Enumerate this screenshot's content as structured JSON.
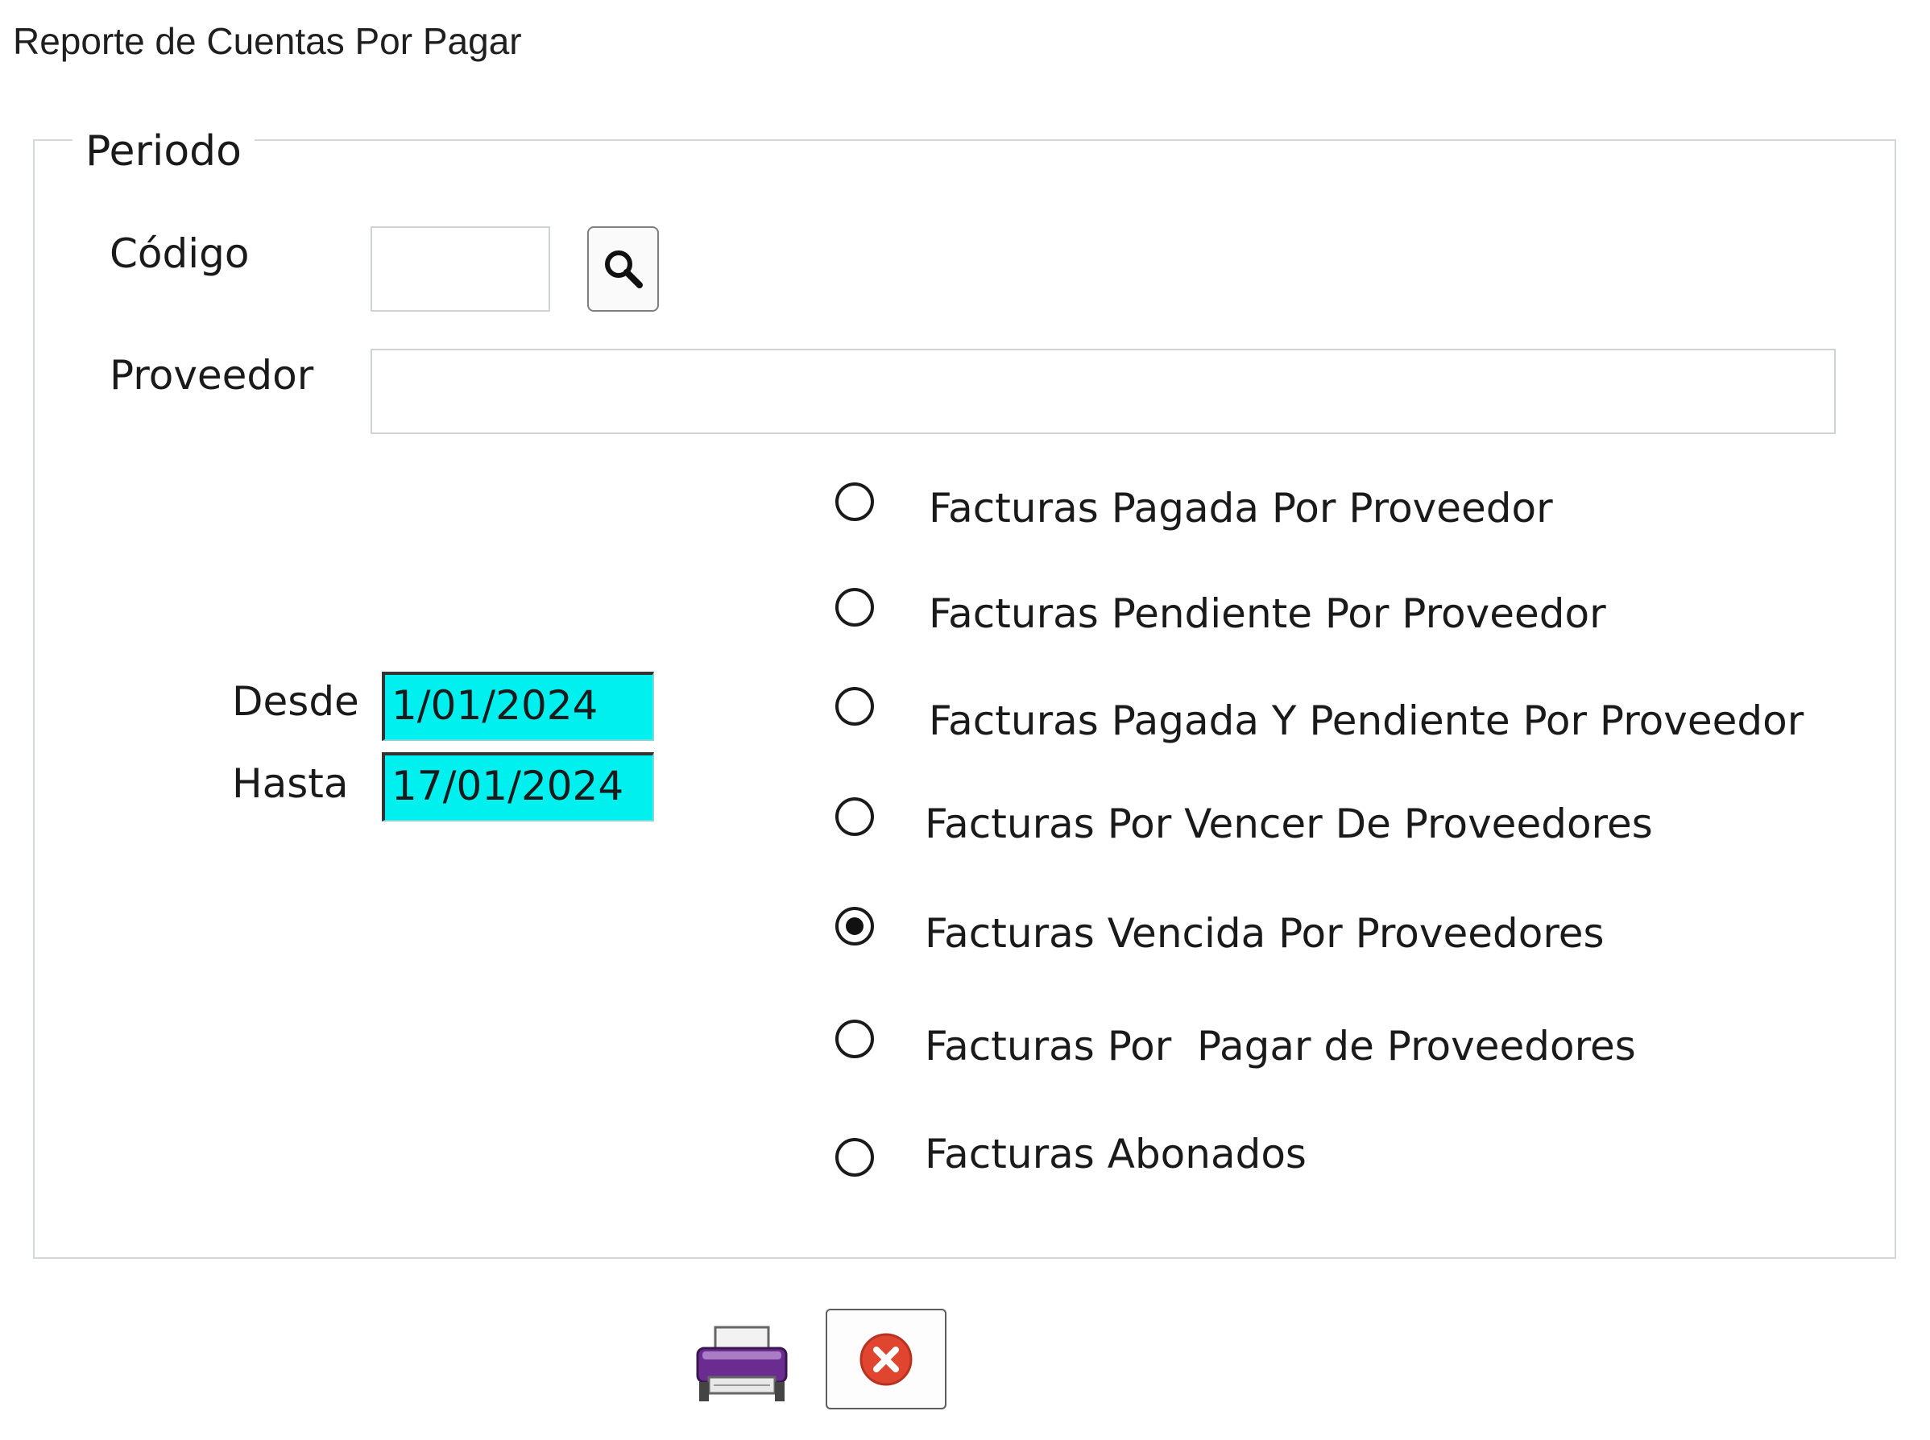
{
  "window": {
    "title": "Reporte de Cuentas Por Pagar"
  },
  "group": {
    "legend": "Periodo"
  },
  "fields": {
    "codigo_label": "Código",
    "codigo_value": "",
    "proveedor_label": "Proveedor",
    "proveedor_value": "",
    "desde_label": "Desde",
    "desde_value": "1/01/2024",
    "hasta_label": "Hasta",
    "hasta_value": "17/01/2024"
  },
  "report_options": [
    {
      "label": "Facturas Pagada Por Proveedor",
      "selected": false
    },
    {
      "label": "Facturas Pendiente Por Proveedor",
      "selected": false
    },
    {
      "label": "Facturas Pagada Y Pendiente Por Proveedor",
      "selected": false
    },
    {
      "label": "Facturas Por Vencer De Proveedores",
      "selected": false
    },
    {
      "label": "Facturas Vencida Por Proveedores",
      "selected": true
    },
    {
      "label": "Facturas Por  Pagar de Proveedores",
      "selected": false
    },
    {
      "label": "Facturas Abonados",
      "selected": false
    }
  ],
  "icons": {
    "search": "search-icon",
    "print": "printer-icon",
    "close": "close-icon"
  },
  "colors": {
    "date_field_bg": "#00f0f0",
    "close_icon": "#e0452f"
  }
}
